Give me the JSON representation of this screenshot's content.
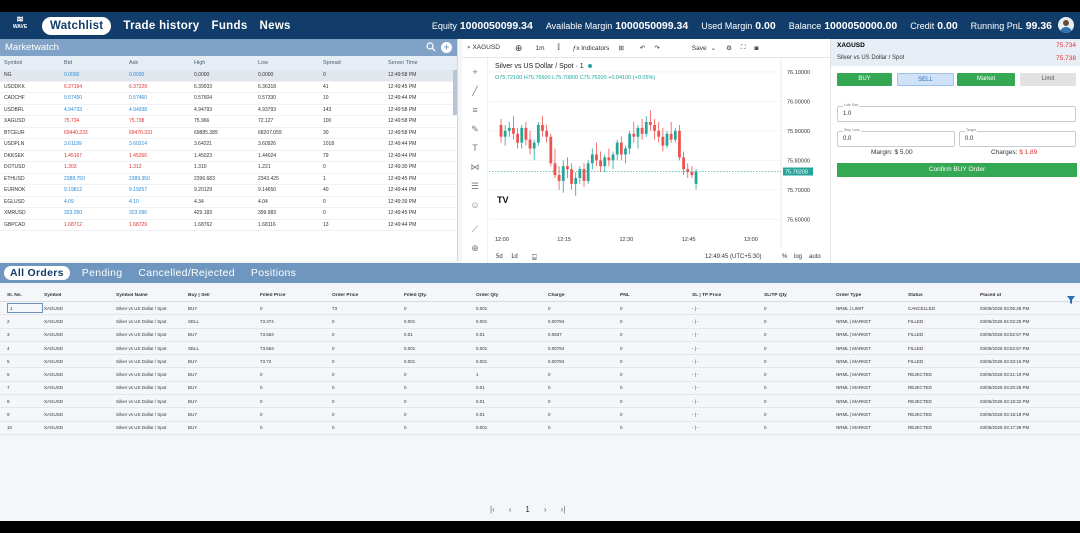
{
  "brand": {
    "logo_text": "WAVE"
  },
  "nav": {
    "items": [
      "Watchlist",
      "Trade history",
      "Funds",
      "News"
    ]
  },
  "stats": [
    {
      "label": "Equity",
      "value": "1000050099.34"
    },
    {
      "label": "Available Margin",
      "value": "1000050099.34"
    },
    {
      "label": "Used Margin",
      "value": "0.00"
    },
    {
      "label": "Balance",
      "value": "1000050000.00"
    },
    {
      "label": "Credit",
      "value": "0.00"
    },
    {
      "label": "Running PnL",
      "value": "99.36"
    }
  ],
  "marketwatch": {
    "title": "Marketwatch",
    "columns": [
      "Symbol",
      "Bid",
      "Ask",
      "High",
      "Low",
      "Spread",
      "Server Time"
    ],
    "rows": [
      [
        "NG",
        "0.0000",
        "0.0000",
        "0.0000",
        "0.0000",
        "0",
        "12:49:58 PM"
      ],
      [
        "USDDKK",
        "6.37194",
        "6.37229",
        "6.39933",
        "6.36318",
        "41",
        "12:49:45 PM"
      ],
      [
        "CADCHF",
        "0.57450",
        "0.57460",
        "0.57604",
        "0.57330",
        "10",
        "12:49:44 PM"
      ],
      [
        "USDBRL",
        "4.94733",
        "4.94938",
        "4.94793",
        "4.93793",
        "143",
        "12:49:58 PM"
      ],
      [
        "XAGUSD",
        "75.734",
        "75.738",
        "75.966",
        "72.127",
        "100",
        "12:49:58 PM"
      ],
      [
        "BTCEUR",
        "69440.233",
        "69470.331",
        "69885.389",
        "68207.059",
        "30",
        "12:49:58 PM"
      ],
      [
        "USDPLN",
        "3.61199",
        "3.60214",
        "3.64221",
        "3.60926",
        "1018",
        "12:49:44 PM"
      ],
      [
        "DKKSEK",
        "1.45167",
        "1.45266",
        "1.45023",
        "1.44024",
        "79",
        "12:49:44 PM"
      ],
      [
        "DOTUSD",
        "1.303",
        "1.312",
        "1.310",
        "1.221",
        "0",
        "12:49:30 PM"
      ],
      [
        "ETHUSD",
        "2388.750",
        "2389.350",
        "2396.683",
        "2343.425",
        "1",
        "12:49:45 PM"
      ],
      [
        "EURNOK",
        "9.19812",
        "9.19257",
        "9.20129",
        "9.14650",
        "40",
        "12:49:44 PM"
      ],
      [
        "EGLUSD",
        "4.09",
        "4.10",
        "4.34",
        "4.04",
        "0",
        "12:49:39 PM"
      ],
      [
        "XMRUSD",
        "323.050",
        "323.096",
        "429.183",
        "399.983",
        "0",
        "12:49:45 PM"
      ],
      [
        "GBPCAD",
        "1.68712",
        "1.68729",
        "1.68762",
        "1.68116",
        "13",
        "12:49:44 PM"
      ]
    ]
  },
  "chart_toolbar": {
    "symbol": "XAGUSD",
    "interval": "1m",
    "indicators": "Indicators",
    "save": "Save"
  },
  "chart_data": {
    "type": "candlestick",
    "title": "Silver vs US Dollar / Spot · 1",
    "ohlc": "O75.72100 H75.76600 L75.70800 C75.76200 +0.04100 (+0.05%)",
    "y_ticks": [
      "76.10000",
      "76.00000",
      "75.90000",
      "75.80000",
      "75.70000",
      "75.60000"
    ],
    "y_range": [
      75.55,
      76.12
    ],
    "x_ticks": [
      "12:00",
      "12:15",
      "12:30",
      "12:45",
      "13:00"
    ],
    "x_range_minutes": [
      0,
      73
    ],
    "current_price": "75.76200",
    "candles": [
      [
        0,
        75.92,
        75.94,
        75.86,
        75.88
      ],
      [
        1,
        75.88,
        75.92,
        75.85,
        75.9
      ],
      [
        2,
        75.9,
        75.93,
        75.88,
        75.91
      ],
      [
        3,
        75.91,
        75.95,
        75.87,
        75.89
      ],
      [
        4,
        75.89,
        75.91,
        75.84,
        75.86
      ],
      [
        5,
        75.86,
        75.92,
        75.84,
        75.91
      ],
      [
        6,
        75.91,
        75.93,
        75.85,
        75.87
      ],
      [
        7,
        75.87,
        75.9,
        75.82,
        75.84
      ],
      [
        8,
        75.84,
        75.87,
        75.8,
        75.86
      ],
      [
        9,
        75.86,
        75.93,
        75.85,
        75.92
      ],
      [
        10,
        75.92,
        75.95,
        75.88,
        75.9
      ],
      [
        11,
        75.9,
        75.92,
        75.86,
        75.88
      ],
      [
        12,
        75.88,
        75.89,
        75.78,
        75.79
      ],
      [
        13,
        75.79,
        75.84,
        75.74,
        75.75
      ],
      [
        14,
        75.75,
        75.78,
        75.7,
        75.73
      ],
      [
        15,
        75.73,
        75.8,
        75.69,
        75.78
      ],
      [
        16,
        75.78,
        75.81,
        75.74,
        75.77
      ],
      [
        17,
        75.77,
        75.79,
        75.7,
        75.72
      ],
      [
        18,
        75.72,
        75.76,
        75.68,
        75.74
      ],
      [
        19,
        75.74,
        75.78,
        75.72,
        75.77
      ],
      [
        20,
        75.77,
        75.79,
        75.71,
        75.73
      ],
      [
        21,
        75.73,
        75.8,
        75.72,
        75.79
      ],
      [
        22,
        75.79,
        75.84,
        75.77,
        75.82
      ],
      [
        23,
        75.82,
        75.86,
        75.78,
        75.8
      ],
      [
        24,
        75.8,
        75.83,
        75.76,
        75.78
      ],
      [
        25,
        75.78,
        75.82,
        75.76,
        75.81
      ],
      [
        26,
        75.81,
        75.84,
        75.78,
        75.8
      ],
      [
        27,
        75.8,
        75.83,
        75.77,
        75.82
      ],
      [
        28,
        75.82,
        75.87,
        75.8,
        75.86
      ],
      [
        29,
        75.86,
        75.88,
        75.8,
        75.82
      ],
      [
        30,
        75.82,
        75.85,
        75.79,
        75.84
      ],
      [
        31,
        75.84,
        75.9,
        75.82,
        75.89
      ],
      [
        32,
        75.89,
        75.93,
        75.86,
        75.88
      ],
      [
        33,
        75.88,
        75.92,
        75.84,
        75.91
      ],
      [
        34,
        75.91,
        75.94,
        75.87,
        75.89
      ],
      [
        35,
        75.89,
        75.95,
        75.88,
        75.93
      ],
      [
        36,
        75.93,
        75.97,
        75.9,
        75.92
      ],
      [
        37,
        75.92,
        75.94,
        75.87,
        75.9
      ],
      [
        38,
        75.9,
        75.93,
        75.86,
        75.88
      ],
      [
        39,
        75.88,
        75.91,
        75.83,
        75.85
      ],
      [
        40,
        75.85,
        75.9,
        75.84,
        75.89
      ],
      [
        41,
        75.89,
        75.93,
        75.86,
        75.87
      ],
      [
        42,
        75.87,
        75.91,
        75.86,
        75.9
      ],
      [
        43,
        75.9,
        75.92,
        75.8,
        75.81
      ],
      [
        44,
        75.81,
        75.83,
        75.75,
        75.77
      ],
      [
        45,
        75.77,
        75.79,
        75.74,
        75.76
      ],
      [
        46,
        75.76,
        75.78,
        75.74,
        75.75
      ],
      [
        47,
        75.72,
        75.77,
        75.7,
        75.762
      ]
    ]
  },
  "chart_bottom": {
    "ranges": [
      "5d",
      "1d"
    ],
    "time": "12:49:45 (UTC+5:30)",
    "log": "log",
    "auto": "auto",
    "pct": "%"
  },
  "order_panel": {
    "symbol": "XAGUSD",
    "name": "Silver vs US Dollar / Spot",
    "bid": "75.734",
    "ask": "75.738",
    "buy": "BUY",
    "sell": "SELL",
    "market": "Market",
    "limit": "Limit",
    "lot_label": "Lots Size",
    "lot_value": "1.0",
    "sl_label": "Stop Loss",
    "sl_value": "0.0",
    "tp_label": "Target",
    "tp_value": "0.0",
    "margin_label": "Margin:",
    "margin_value": "$ 5.00",
    "charges_label": "Charges:",
    "charges_value": "$ 1.89",
    "confirm": "Confirm BUY Order"
  },
  "orders": {
    "tabs": [
      "All Orders",
      "Pending",
      "Cancelled/Rejected",
      "Positions"
    ],
    "columns": [
      "Sl. No.",
      "Symbol",
      "Symbol Name",
      "Buy | Sell",
      "Filled Price",
      "Order Price",
      "Filled Qty.",
      "Order Qty",
      "Charge",
      "PNL",
      "SL | TP Price",
      "SL/TP Qty",
      "Order Type",
      "Status",
      "Placed at"
    ],
    "rows": [
      [
        "1",
        "XAGUSD",
        "Silver vs US Dollar / Spot",
        "BUY",
        "0",
        "73",
        "0",
        "0.001",
        "0",
        "0",
        "- | -",
        "0",
        "NRML | LIMIT",
        "CANCELLED",
        "03/05/2026 03:05:28 PM"
      ],
      [
        "2",
        "XAGUSD",
        "Silver vs US Dollar / Spot",
        "SELL",
        "73.374",
        "0",
        "0.001",
        "0.001",
        "0.00784",
        "0",
        "- | -",
        "0",
        "NRML | MARKET",
        "FILLED",
        "03/05/2026 04:02:25 PM"
      ],
      [
        "3",
        "XAGUSD",
        "Silver vs US Dollar / Spot",
        "BUY",
        "73.663",
        "0",
        "0.01",
        "0.01",
        "0.0837",
        "0",
        "- | -",
        "0",
        "NRML | MARKET",
        "FILLED",
        "03/05/2026 03:52:57 PM"
      ],
      [
        "4",
        "XAGUSD",
        "Silver vs US Dollar / Spot",
        "SELL",
        "73.663",
        "0",
        "0.001",
        "0.001",
        "0.00784",
        "0",
        "- | -",
        "0",
        "NRML | MARKET",
        "FILLED",
        "03/05/2026 03:52:57 PM"
      ],
      [
        "5",
        "XAGUSD",
        "Silver vs US Dollar / Spot",
        "BUY",
        "73.72",
        "0",
        "0.001",
        "0.001",
        "0.00784",
        "0",
        "- | -",
        "0",
        "NRML | MARKET",
        "FILLED",
        "03/05/2026 03:33:16 PM"
      ],
      [
        "6",
        "XAGUSD",
        "Silver vs US Dollar / Spot",
        "BUY",
        "0",
        "0",
        "0",
        "1",
        "0",
        "0",
        "- | -",
        "0",
        "NRML | MARKET",
        "REJECTED",
        "03/05/2026 03:21:19 PM"
      ],
      [
        "7",
        "XAGUSD",
        "Silver vs US Dollar / Spot",
        "BUY",
        "0",
        "0",
        "0",
        "0.01",
        "0",
        "0",
        "- | -",
        "0",
        "NRML | MARKET",
        "REJECTED",
        "03/05/2026 03:20:28 PM"
      ],
      [
        "8",
        "XAGUSD",
        "Silver vs US Dollar / Spot",
        "BUY",
        "0",
        "0",
        "0",
        "0.01",
        "0",
        "0",
        "- | -",
        "0",
        "NRML | MARKET",
        "REJECTED",
        "03/05/2026 03:19:32 PM"
      ],
      [
        "9",
        "XAGUSD",
        "Silver vs US Dollar / Spot",
        "BUY",
        "0",
        "0",
        "0",
        "0.01",
        "0",
        "0",
        "- | -",
        "0",
        "NRML | MARKET",
        "REJECTED",
        "03/05/2026 03:18:18 PM"
      ],
      [
        "10",
        "XAGUSD",
        "Silver vs US Dollar / Spot",
        "BUY",
        "0",
        "0",
        "0",
        "0.001",
        "0",
        "0",
        "- | -",
        "0",
        "NRML | MARKET",
        "REJECTED",
        "03/05/2026 03:17:39 PM"
      ]
    ]
  },
  "pager": {
    "current": "1"
  }
}
